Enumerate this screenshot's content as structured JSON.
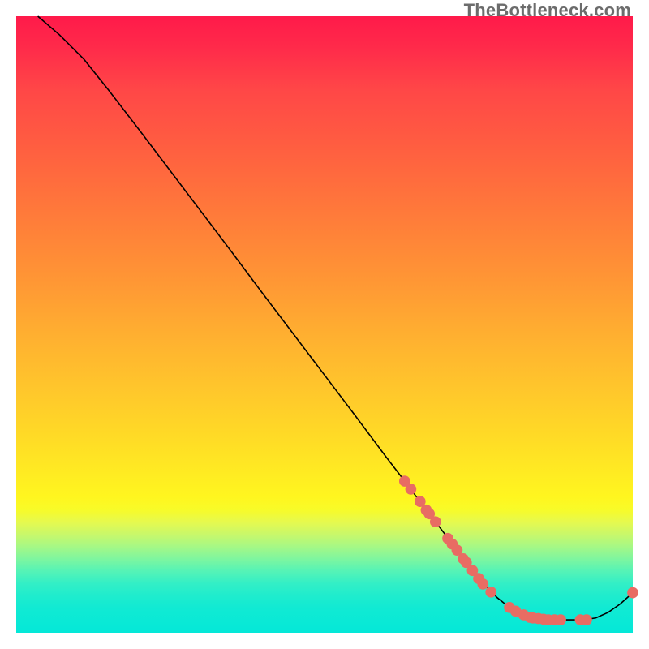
{
  "chart_data": {
    "type": "line",
    "title": "",
    "xlabel": "",
    "ylabel": "",
    "xlim": [
      0,
      100
    ],
    "ylim": [
      0,
      100
    ],
    "watermark": "TheBottleneck.com",
    "curve": [
      {
        "x": 3.5,
        "y": 100.0
      },
      {
        "x": 7.0,
        "y": 97.0
      },
      {
        "x": 11.0,
        "y": 93.0
      },
      {
        "x": 15.0,
        "y": 88.0
      },
      {
        "x": 20.0,
        "y": 81.5
      },
      {
        "x": 25.0,
        "y": 74.9
      },
      {
        "x": 30.0,
        "y": 68.3
      },
      {
        "x": 35.0,
        "y": 61.7
      },
      {
        "x": 40.0,
        "y": 55.0
      },
      {
        "x": 45.0,
        "y": 48.4
      },
      {
        "x": 50.0,
        "y": 41.8
      },
      {
        "x": 55.0,
        "y": 35.2
      },
      {
        "x": 60.0,
        "y": 28.5
      },
      {
        "x": 63.0,
        "y": 24.6
      },
      {
        "x": 66.0,
        "y": 20.6
      },
      {
        "x": 69.0,
        "y": 16.7
      },
      {
        "x": 72.0,
        "y": 12.7
      },
      {
        "x": 75.0,
        "y": 8.8
      },
      {
        "x": 78.0,
        "y": 5.7
      },
      {
        "x": 80.0,
        "y": 4.1
      },
      {
        "x": 82.0,
        "y": 3.0
      },
      {
        "x": 84.0,
        "y": 2.4
      },
      {
        "x": 86.0,
        "y": 2.1
      },
      {
        "x": 88.0,
        "y": 2.1
      },
      {
        "x": 90.0,
        "y": 2.1
      },
      {
        "x": 92.0,
        "y": 2.1
      },
      {
        "x": 94.0,
        "y": 2.4
      },
      {
        "x": 96.0,
        "y": 3.3
      },
      {
        "x": 98.0,
        "y": 4.7
      },
      {
        "x": 100.0,
        "y": 6.5
      }
    ],
    "points": [
      {
        "x": 63.0,
        "y": 24.6
      },
      {
        "x": 64.0,
        "y": 23.3
      },
      {
        "x": 65.5,
        "y": 21.3
      },
      {
        "x": 66.5,
        "y": 19.9
      },
      {
        "x": 67.0,
        "y": 19.3
      },
      {
        "x": 68.0,
        "y": 18.0
      },
      {
        "x": 70.0,
        "y": 15.3
      },
      {
        "x": 70.7,
        "y": 14.4
      },
      {
        "x": 71.5,
        "y": 13.4
      },
      {
        "x": 72.5,
        "y": 12.0
      },
      {
        "x": 73.0,
        "y": 11.4
      },
      {
        "x": 74.0,
        "y": 10.1
      },
      {
        "x": 75.0,
        "y": 8.8
      },
      {
        "x": 75.7,
        "y": 7.9
      },
      {
        "x": 77.0,
        "y": 6.6
      },
      {
        "x": 80.0,
        "y": 4.1
      },
      {
        "x": 81.0,
        "y": 3.5
      },
      {
        "x": 82.3,
        "y": 2.9
      },
      {
        "x": 83.3,
        "y": 2.5
      },
      {
        "x": 83.8,
        "y": 2.4
      },
      {
        "x": 84.7,
        "y": 2.3
      },
      {
        "x": 85.5,
        "y": 2.2
      },
      {
        "x": 86.3,
        "y": 2.1
      },
      {
        "x": 87.3,
        "y": 2.1
      },
      {
        "x": 88.3,
        "y": 2.1
      },
      {
        "x": 91.5,
        "y": 2.1
      },
      {
        "x": 92.5,
        "y": 2.1
      },
      {
        "x": 100.0,
        "y": 6.5
      }
    ],
    "colors": {
      "point": "#e86c63",
      "curve": "#000000"
    }
  }
}
